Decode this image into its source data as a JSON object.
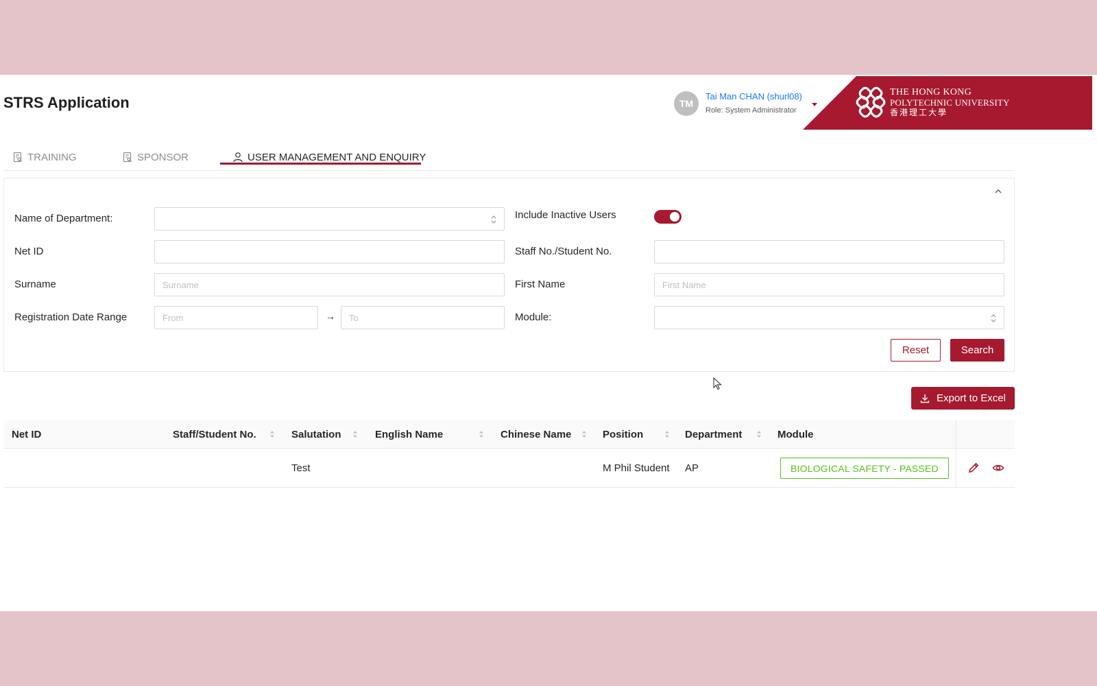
{
  "app": {
    "title": "STRS Application"
  },
  "user": {
    "initials": "TM",
    "name": "Tai Man CHAN (shurl08)",
    "role": "Role: System Administrator"
  },
  "brand": {
    "line1": "THE HONG KONG",
    "line2": "POLYTECHNIC UNIVERSITY",
    "line3": "香港理工大學"
  },
  "tabs": [
    {
      "label": "TRAINING",
      "icon": "document-search-icon"
    },
    {
      "label": "SPONSOR",
      "icon": "document-search-icon"
    },
    {
      "label": "USER MANAGEMENT AND ENQUIRY",
      "icon": "user-icon",
      "active": true
    }
  ],
  "filters": {
    "department_label": "Name of Department:",
    "department_value": "",
    "include_inactive_label": "Include Inactive Users",
    "include_inactive": true,
    "netid_label": "Net ID",
    "netid_value": "",
    "staff_no_label": "Staff No./Student No.",
    "staff_no_value": "",
    "surname_label": "Surname",
    "surname_placeholder": "Surname",
    "firstname_label": "First Name",
    "firstname_placeholder": "First Name",
    "reg_date_label": "Registration Date Range",
    "from_placeholder": "From",
    "to_placeholder": "To",
    "range_arrow": "→",
    "module_label": "Module:",
    "module_value": "",
    "reset_label": "Reset",
    "search_label": "Search"
  },
  "export_label": "Export to Excel",
  "table": {
    "columns": [
      "Net ID",
      "Staff/Student No.",
      "Salutation",
      "English Name",
      "Chinese Name",
      "Position",
      "Department",
      "Module"
    ],
    "rows": [
      {
        "netid": "",
        "staff_no": "",
        "salutation": "Test",
        "english_name": "",
        "chinese_name": "",
        "position": "M Phil Student",
        "department": "AP",
        "module": "BIOLOGICAL SAFETY - PASSED"
      }
    ]
  },
  "colors": {
    "brand": "#a6192e",
    "link": "#1677ff",
    "success": "#52c41a"
  }
}
